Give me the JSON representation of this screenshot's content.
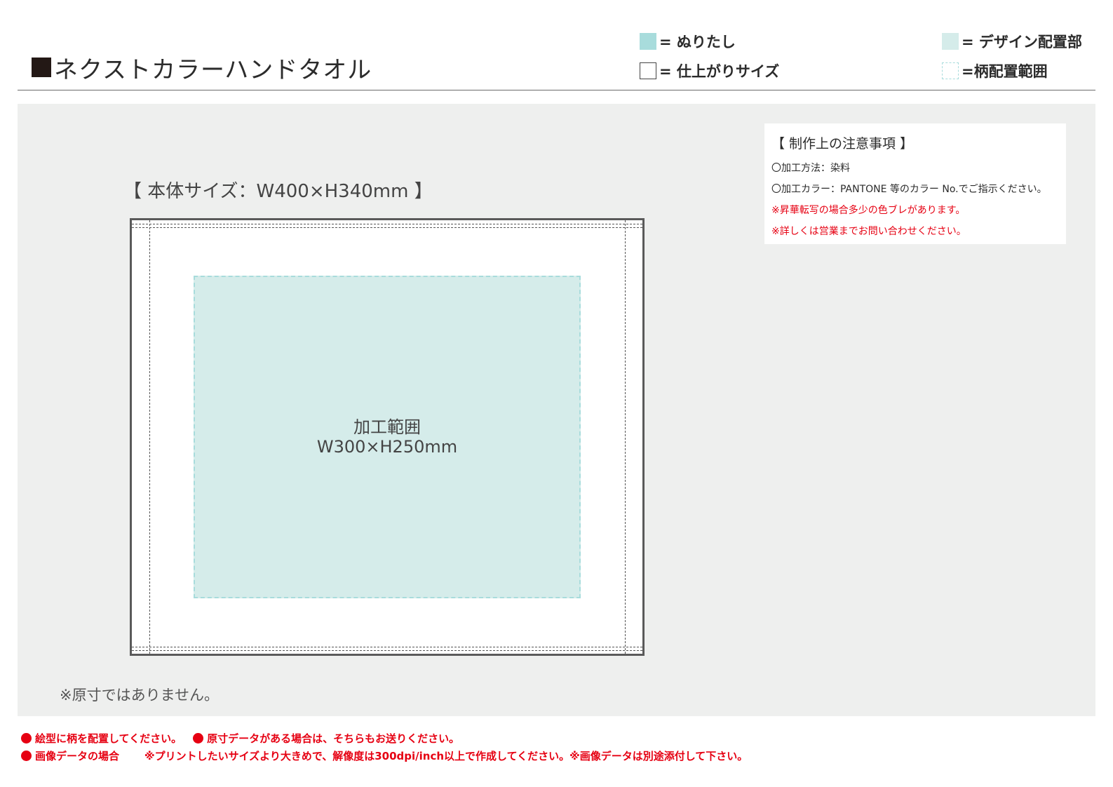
{
  "header": {
    "title": "ネクストカラーハンドタオル"
  },
  "legend": {
    "bleed": "= ぬりたし",
    "trim": "= 仕上がりサイズ",
    "design": "= デザイン配置部",
    "pattern": "=柄配置範囲"
  },
  "template": {
    "body_size": "【 本体サイズ：W400×H340mm 】",
    "print_area_title": "加工範囲",
    "print_area_size": "W300×H250mm",
    "not_actual_size": "※原寸ではありません。"
  },
  "notes": {
    "title": "【 制作上の注意事項 】",
    "lines": [
      "〇加工方法：染料",
      "〇加工カラー：PANTONE 等のカラー No.でご指示ください。"
    ],
    "warnings": [
      "※昇華転写の場合多少の色ブレがあります。",
      "※詳しくは営業までお問い合わせください。"
    ]
  },
  "footer": {
    "item1": "絵型に柄を配置してください。",
    "item2": "原寸データがある場合は、そちらもお送りください。",
    "item3_label": "画像データの場合",
    "item3_text": "※プリントしたいサイズより大きめで、解像度は300dpi/inch以上で作成してください。※画像データは別途添付して下さい。"
  },
  "colors": {
    "bleed": "#a8dcdc",
    "design": "#d5ecea",
    "warning": "#e60012",
    "panel": "#eeefee"
  }
}
